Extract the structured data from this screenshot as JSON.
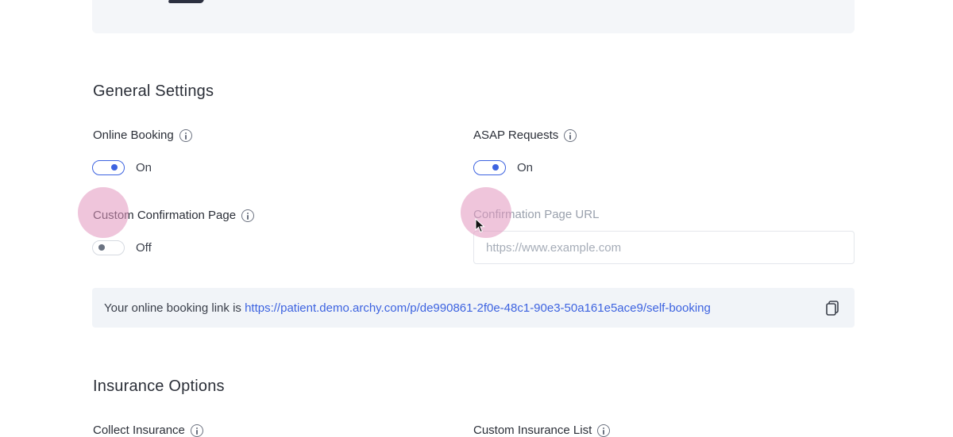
{
  "general": {
    "title": "General Settings",
    "online_booking": {
      "label": "Online Booking",
      "state": "On"
    },
    "asap_requests": {
      "label": "ASAP Requests",
      "state": "On"
    },
    "custom_confirmation": {
      "label": "Custom Confirmation Page",
      "state": "Off"
    },
    "confirmation_url": {
      "label": "Confirmation Page URL",
      "placeholder": "https://www.example.com",
      "value": ""
    },
    "booking_link": {
      "prefix": "Your online booking link is ",
      "url": "https://patient.demo.archy.com/p/de990861-2f0e-48c1-90e3-50a161e5ace9/self-booking"
    }
  },
  "insurance": {
    "title": "Insurance Options",
    "collect_insurance": {
      "label": "Collect Insurance"
    },
    "custom_insurance_list": {
      "label": "Custom Insurance List"
    }
  },
  "icons": [
    "info-icon",
    "copy-icon",
    "cursor-icon"
  ],
  "colors": {
    "accent": "#3d63e0",
    "text": "#2b2f38",
    "muted": "#9aa1ad",
    "banner_bg": "#f1f4f8",
    "click_highlight": "#e296be"
  }
}
